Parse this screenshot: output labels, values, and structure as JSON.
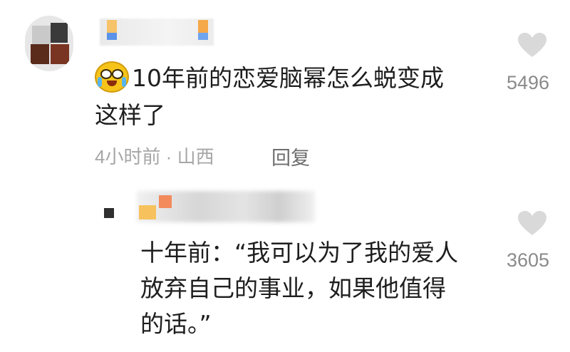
{
  "comment": {
    "author_name": "",
    "emoji": "crying-laughing-emoji",
    "text_line1": "10年前的恋爱脑幂怎么蜕变成",
    "text_line2": "这样了",
    "meta": "4小时前 · 山西",
    "reply_label": "回复",
    "like_count": "5496"
  },
  "reply": {
    "author_name": "",
    "text_line1": "十年前：“我可以为了我的爱人",
    "text_line2": "放弃自己的事业，如果他值得",
    "text_line3": "的话。”",
    "like_count": "3605"
  },
  "colors": {
    "heart": "#d9d9d9",
    "meta_text": "#a6a6a6",
    "like_text": "#8a8a8a",
    "body_text": "#1e1e1e"
  }
}
